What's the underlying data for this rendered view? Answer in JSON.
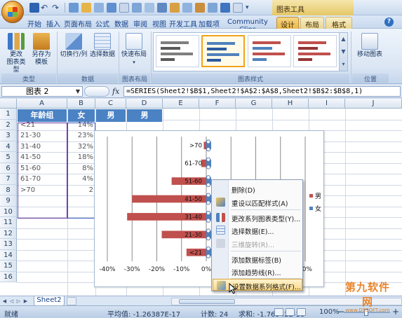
{
  "title_bar": {
    "tool_title": "图表工具"
  },
  "tabs": [
    "开始",
    "插入",
    "页面布局",
    "公式",
    "数据",
    "审阅",
    "视图",
    "开发工具",
    "加载项",
    "Community Clips",
    "设计",
    "布局",
    "格式"
  ],
  "ribbon": {
    "groups": {
      "type": "类型",
      "data": "数据",
      "layout": "图表布局",
      "styles": "图表样式",
      "location": "位置"
    },
    "buttons": {
      "change_type_l1": "更改",
      "change_type_l2": "图表类型",
      "save_template_l1": "另存为",
      "save_template_l2": "模板",
      "switch_row_col": "切换行/列",
      "select_data": "选择数据",
      "quick_layout": "快速布局",
      "move_chart": "移动图表"
    }
  },
  "formula_bar": {
    "name_box": "图表 2",
    "fx": "fx",
    "formula": "=SERIES(Sheet2!$B$1,Sheet2!$A$2:$A$8,Sheet2!$B$2:$B$8,1)"
  },
  "sheet": {
    "columns": [
      "A",
      "B",
      "C",
      "D",
      "E",
      "F",
      "G",
      "H",
      "I",
      "J"
    ],
    "rows": [
      "1",
      "2",
      "3",
      "4",
      "5",
      "6",
      "7",
      "8",
      "9",
      "10",
      "11",
      "12",
      "13",
      "14",
      "15",
      "16"
    ],
    "header_row": [
      "年龄组",
      "女",
      "男",
      "男"
    ],
    "col_a": [
      "<21",
      "21-30",
      "31-40",
      "41-50",
      "51-60",
      "61-70",
      ">70"
    ],
    "col_b": [
      "14%",
      "23%",
      "32%",
      "18%",
      "8%",
      "4%",
      "2"
    ]
  },
  "chart_data": {
    "type": "bar",
    "orientation": "horizontal",
    "categories": [
      "<21",
      "21-30",
      "31-40",
      "41-50",
      "51-60",
      "61-70",
      ">70"
    ],
    "series": [
      {
        "name": "男",
        "color": "#c0504d",
        "values": [
          -8,
          -18,
          -32,
          -30,
          -14,
          -2,
          -1
        ]
      },
      {
        "name": "女",
        "color": "#4f81bd",
        "values": [
          0,
          0,
          0,
          0,
          0,
          0,
          0
        ]
      }
    ],
    "x_ticks": [
      "-40%",
      "-30%",
      "-20%",
      "-10%",
      "0%",
      "10%",
      "20%",
      "30%",
      "40%"
    ],
    "xlim": [
      -40,
      40
    ],
    "legend": [
      "男",
      "女"
    ],
    "legend_position": "right",
    "grid": true
  },
  "context_menu": {
    "items": [
      {
        "label": "删除(D)",
        "icon": "delete-icon",
        "enabled": true
      },
      {
        "label": "重设以匹配样式(A)",
        "icon": "reset-style-icon",
        "enabled": true
      },
      {
        "label": "更改系列图表类型(Y)...",
        "icon": "chart-type-icon",
        "enabled": true
      },
      {
        "label": "选择数据(E)...",
        "icon": "select-data-icon",
        "enabled": true
      },
      {
        "label": "三维旋转(R)...",
        "icon": "3d-rotate-icon",
        "enabled": false
      },
      {
        "label": "添加数据标签(B)",
        "icon": "",
        "enabled": true
      },
      {
        "label": "添加趋势线(R)...",
        "icon": "",
        "enabled": true
      },
      {
        "label": "设置数据系列格式(F)...",
        "icon": "format-series-icon",
        "enabled": true
      }
    ]
  },
  "sheet_tabs": {
    "active": "Sheet2"
  },
  "status_bar": {
    "mode": "就绪",
    "average": "平均值: -1.26387E-17",
    "count": "计数: 24",
    "sum": "求和: -1.76942E-16",
    "zoom": "100%"
  },
  "watermark": {
    "line1": "第九软件网",
    "line2": "www.D9SOFT.com"
  },
  "colors": {
    "accent": "#f0a31c",
    "header_fill": "#4a82c4",
    "male": "#c0504d",
    "female": "#4f81bd"
  }
}
